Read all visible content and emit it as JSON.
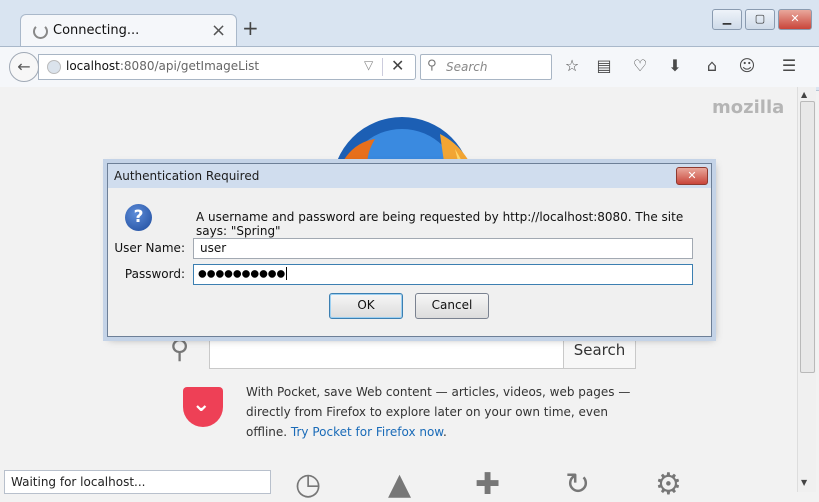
{
  "browser": {
    "tab_title": "Connecting...",
    "new_tab": "+",
    "close_tab": "×",
    "window_buttons": {
      "minimize": "▁",
      "maximize": "▢",
      "close": "✕"
    },
    "url_host": "localhost",
    "url_rest": ":8080/api/getImageList",
    "search_placeholder": "Search",
    "toolbar_icons": [
      "bookmark-star-icon",
      "reading-list-icon",
      "pocket-icon",
      "download-icon",
      "home-icon",
      "hello-icon",
      "menu-icon"
    ]
  },
  "page": {
    "brand": "mozilla",
    "search_button": "Search",
    "pocket_text": "With Pocket, save Web content — articles, videos, web pages — directly from Firefox to explore later on your own time, even offline.",
    "pocket_link": "Try Pocket for Firefox now",
    "pocket_link_suffix": ".",
    "status": "Waiting for localhost..."
  },
  "dialog": {
    "title": "Authentication Required",
    "close": "✕",
    "message": "A username and password are being requested by http://localhost:8080. The site says: \"Spring\"",
    "username_label": "User Name:",
    "username_value": "user",
    "password_label": "Password:",
    "password_value": "●●●●●●●●●●",
    "ok_label": "OK",
    "cancel_label": "Cancel"
  },
  "colors": {
    "accent": "#3c7fb1",
    "pocket": "#ee4056",
    "link": "#1a6bb8"
  }
}
